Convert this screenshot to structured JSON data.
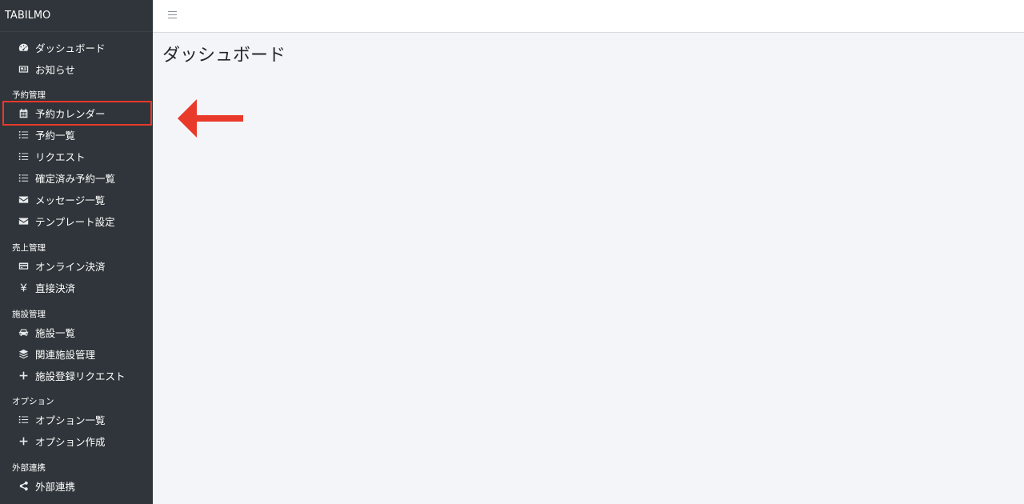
{
  "brand": "TABILMO",
  "sections": {
    "reservation": "予約管理",
    "sales": "売上管理",
    "facility": "施設管理",
    "option": "オプション",
    "external": "外部連携"
  },
  "nav": {
    "dashboard": {
      "label": "ダッシュボード",
      "icon": "dashboard-icon"
    },
    "news": {
      "label": "お知らせ",
      "icon": "newspaper-icon"
    },
    "calendar": {
      "label": "予約カレンダー",
      "icon": "calendar-icon"
    },
    "reservation_list": {
      "label": "予約一覧",
      "icon": "list-icon"
    },
    "request": {
      "label": "リクエスト",
      "icon": "list-icon"
    },
    "confirmed_list": {
      "label": "確定済み予約一覧",
      "icon": "list-icon"
    },
    "message_list": {
      "label": "メッセージ一覧",
      "icon": "envelope-icon"
    },
    "template": {
      "label": "テンプレート設定",
      "icon": "envelope-icon"
    },
    "online_payment": {
      "label": "オンライン決済",
      "icon": "credit-card-icon"
    },
    "direct_payment": {
      "label": "直接決済",
      "icon": "yen-icon"
    },
    "facility_list": {
      "label": "施設一覧",
      "icon": "car-icon"
    },
    "related_facility": {
      "label": "関連施設管理",
      "icon": "layers-icon"
    },
    "facility_request": {
      "label": "施設登録リクエスト",
      "icon": "plus-icon"
    },
    "option_list": {
      "label": "オプション一覧",
      "icon": "list-icon"
    },
    "option_create": {
      "label": "オプション作成",
      "icon": "plus-icon"
    },
    "external_link": {
      "label": "外部連携",
      "icon": "share-icon"
    }
  },
  "main": {
    "title": "ダッシュボード"
  },
  "colors": {
    "sidebar": "#2f353a",
    "highlight": "#e9392b",
    "background": "#f4f5f9"
  }
}
